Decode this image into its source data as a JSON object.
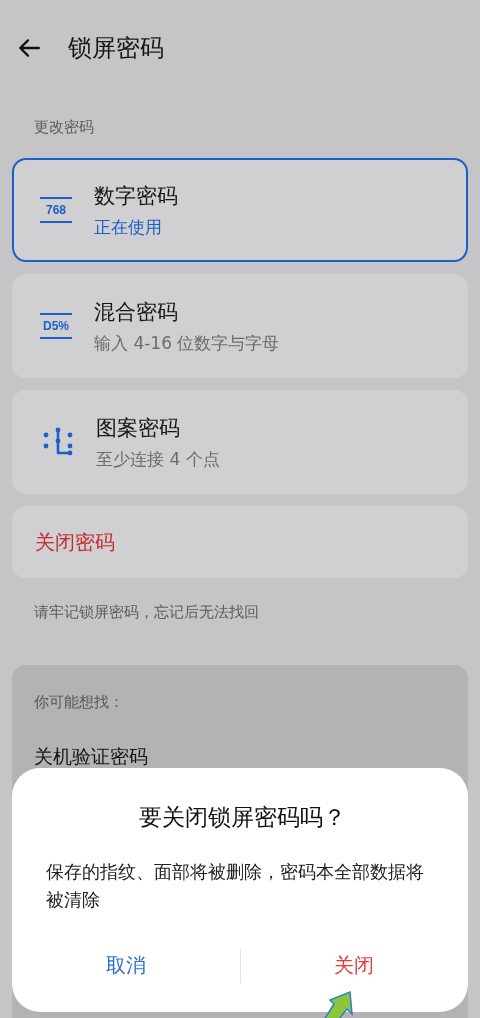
{
  "header": {
    "title": "锁屏密码"
  },
  "section_label": "更改密码",
  "options": [
    {
      "kind": "digits",
      "icon_text": "768",
      "title": "数字密码",
      "subtitle": "正在使用",
      "selected": true
    },
    {
      "kind": "mixed",
      "icon_text": "D5%",
      "title": "混合密码",
      "subtitle": "输入 4-16 位数字与字母",
      "selected": false
    },
    {
      "kind": "pattern",
      "title": "图案密码",
      "subtitle": "至少连接 4 个点",
      "selected": false
    }
  ],
  "close_password": "关闭密码",
  "note": "请牢记锁屏密码，忘记后无法找回",
  "suggestions": {
    "title": "你可能想找：",
    "items": [
      "关机验证密码"
    ]
  },
  "dialog": {
    "title": "要关闭锁屏密码吗？",
    "message": "保存的指纹、面部将被删除，密码本全部数据将被清除",
    "buttons": [
      {
        "kind": "cancel",
        "label": "取消"
      },
      {
        "kind": "confirm",
        "label": "关闭"
      }
    ]
  }
}
